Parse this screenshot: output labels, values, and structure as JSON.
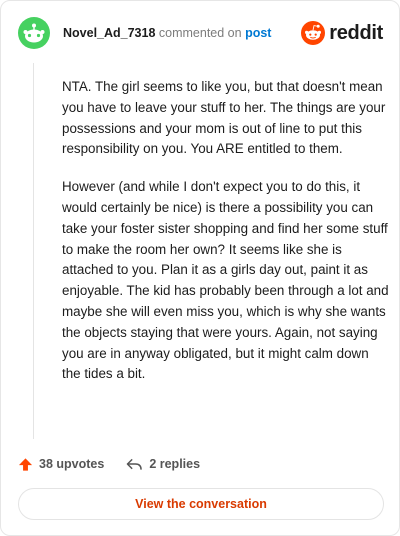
{
  "comment": {
    "username": "Novel_Ad_7318",
    "action_text": "commented on",
    "post_link": "post",
    "paragraphs": [
      "NTA. The girl seems to like you, but that doesn't mean you have to leave your stuff to her. The things are your possessions and your mom is out of line to put this responsibility on you. You ARE entitled to them.",
      "However (and while I don't expect you to do this, it would certainly be nice) is there a possibility you can take your foster sister shopping and find her some stuff to make the room her own? It seems like she is attached to you. Plan it as a girls day out, paint it as enjoyable. The kid has probably been through a lot and maybe she will even miss you, which is why she wants the objects staying that were yours. Again, not saying you are in anyway obligated, but it might calm down the tides a bit."
    ],
    "upvotes": "38 upvotes",
    "replies": "2 replies"
  },
  "brand": {
    "wordmark": "reddit",
    "color": "#ff4500"
  },
  "footer": {
    "view_label": "View the conversation"
  },
  "colors": {
    "accent": "#ff4500",
    "link": "#0079d3",
    "avatar_bg": "#46d160",
    "button_text": "#d93a00"
  },
  "icons": {
    "avatar": "snoo-avatar-icon",
    "logo": "reddit-logo-icon",
    "upvote": "upvote-arrow-icon",
    "reply": "reply-arrow-icon"
  }
}
